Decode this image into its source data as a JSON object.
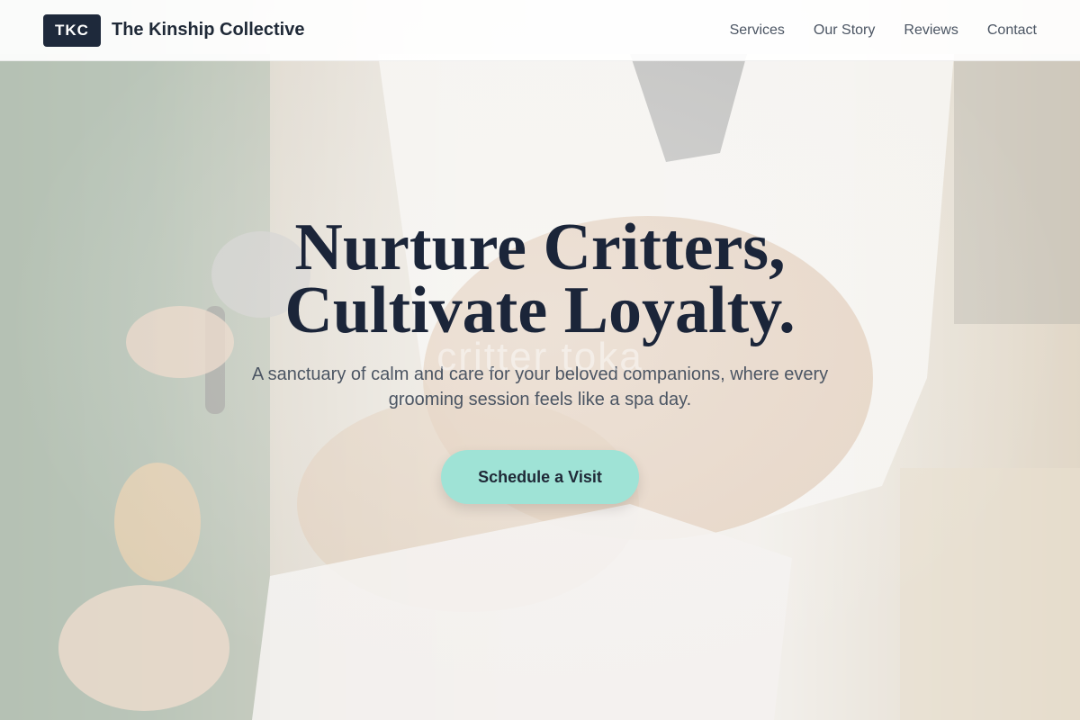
{
  "brand": {
    "badge": "TKC",
    "name": "The Kinship Collective"
  },
  "nav": {
    "items": [
      {
        "label": "Services"
      },
      {
        "label": "Our Story"
      },
      {
        "label": "Reviews"
      },
      {
        "label": "Contact"
      }
    ]
  },
  "hero": {
    "title_line1": "Nurture Critters,",
    "title_line2": "Cultivate Loyalty.",
    "subtitle": "A sanctuary of calm and care for your beloved companions, where every grooming session feels like a spa day.",
    "cta_label": "Schedule a Visit",
    "watermark": "critter toka"
  },
  "colors": {
    "accent": "#9fe3d6",
    "dark": "#1e293b",
    "title": "#1b2539"
  }
}
